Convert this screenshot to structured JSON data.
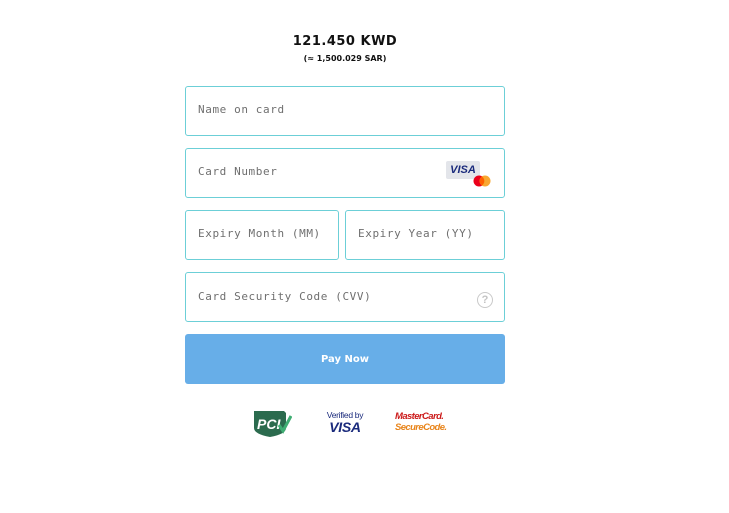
{
  "payment": {
    "amount": "121.450 KWD",
    "converted": "(≈ 1,500.029 SAR)"
  },
  "form": {
    "name_placeholder": "Name on card",
    "name_value": "",
    "card_placeholder": "Card Number",
    "card_value": "",
    "month_placeholder": "Expiry Month (MM)",
    "month_value": "",
    "year_placeholder": "Expiry Year (YY)",
    "year_value": "",
    "cvv_placeholder": "Card Security Code (CVV)",
    "cvv_value": "",
    "card_brands": {
      "visa_label": "VISA",
      "mastercard_icon": "mastercard-icon"
    },
    "help_glyph": "?",
    "submit_label": "Pay Now"
  },
  "security_badges": {
    "pci_label": "PCI",
    "vbv_line1": "Verified by",
    "vbv_line2": "VISA",
    "mc_line1": "MasterCard.",
    "mc_line2": "SecureCode."
  },
  "colors": {
    "field_border": "#6ccfd7",
    "button": "#67aee8",
    "visa_blue": "#1a2a7c",
    "mc_red": "#eb001b",
    "mc_orange": "#f79e1b",
    "pci_green": "#2b6b4e"
  }
}
